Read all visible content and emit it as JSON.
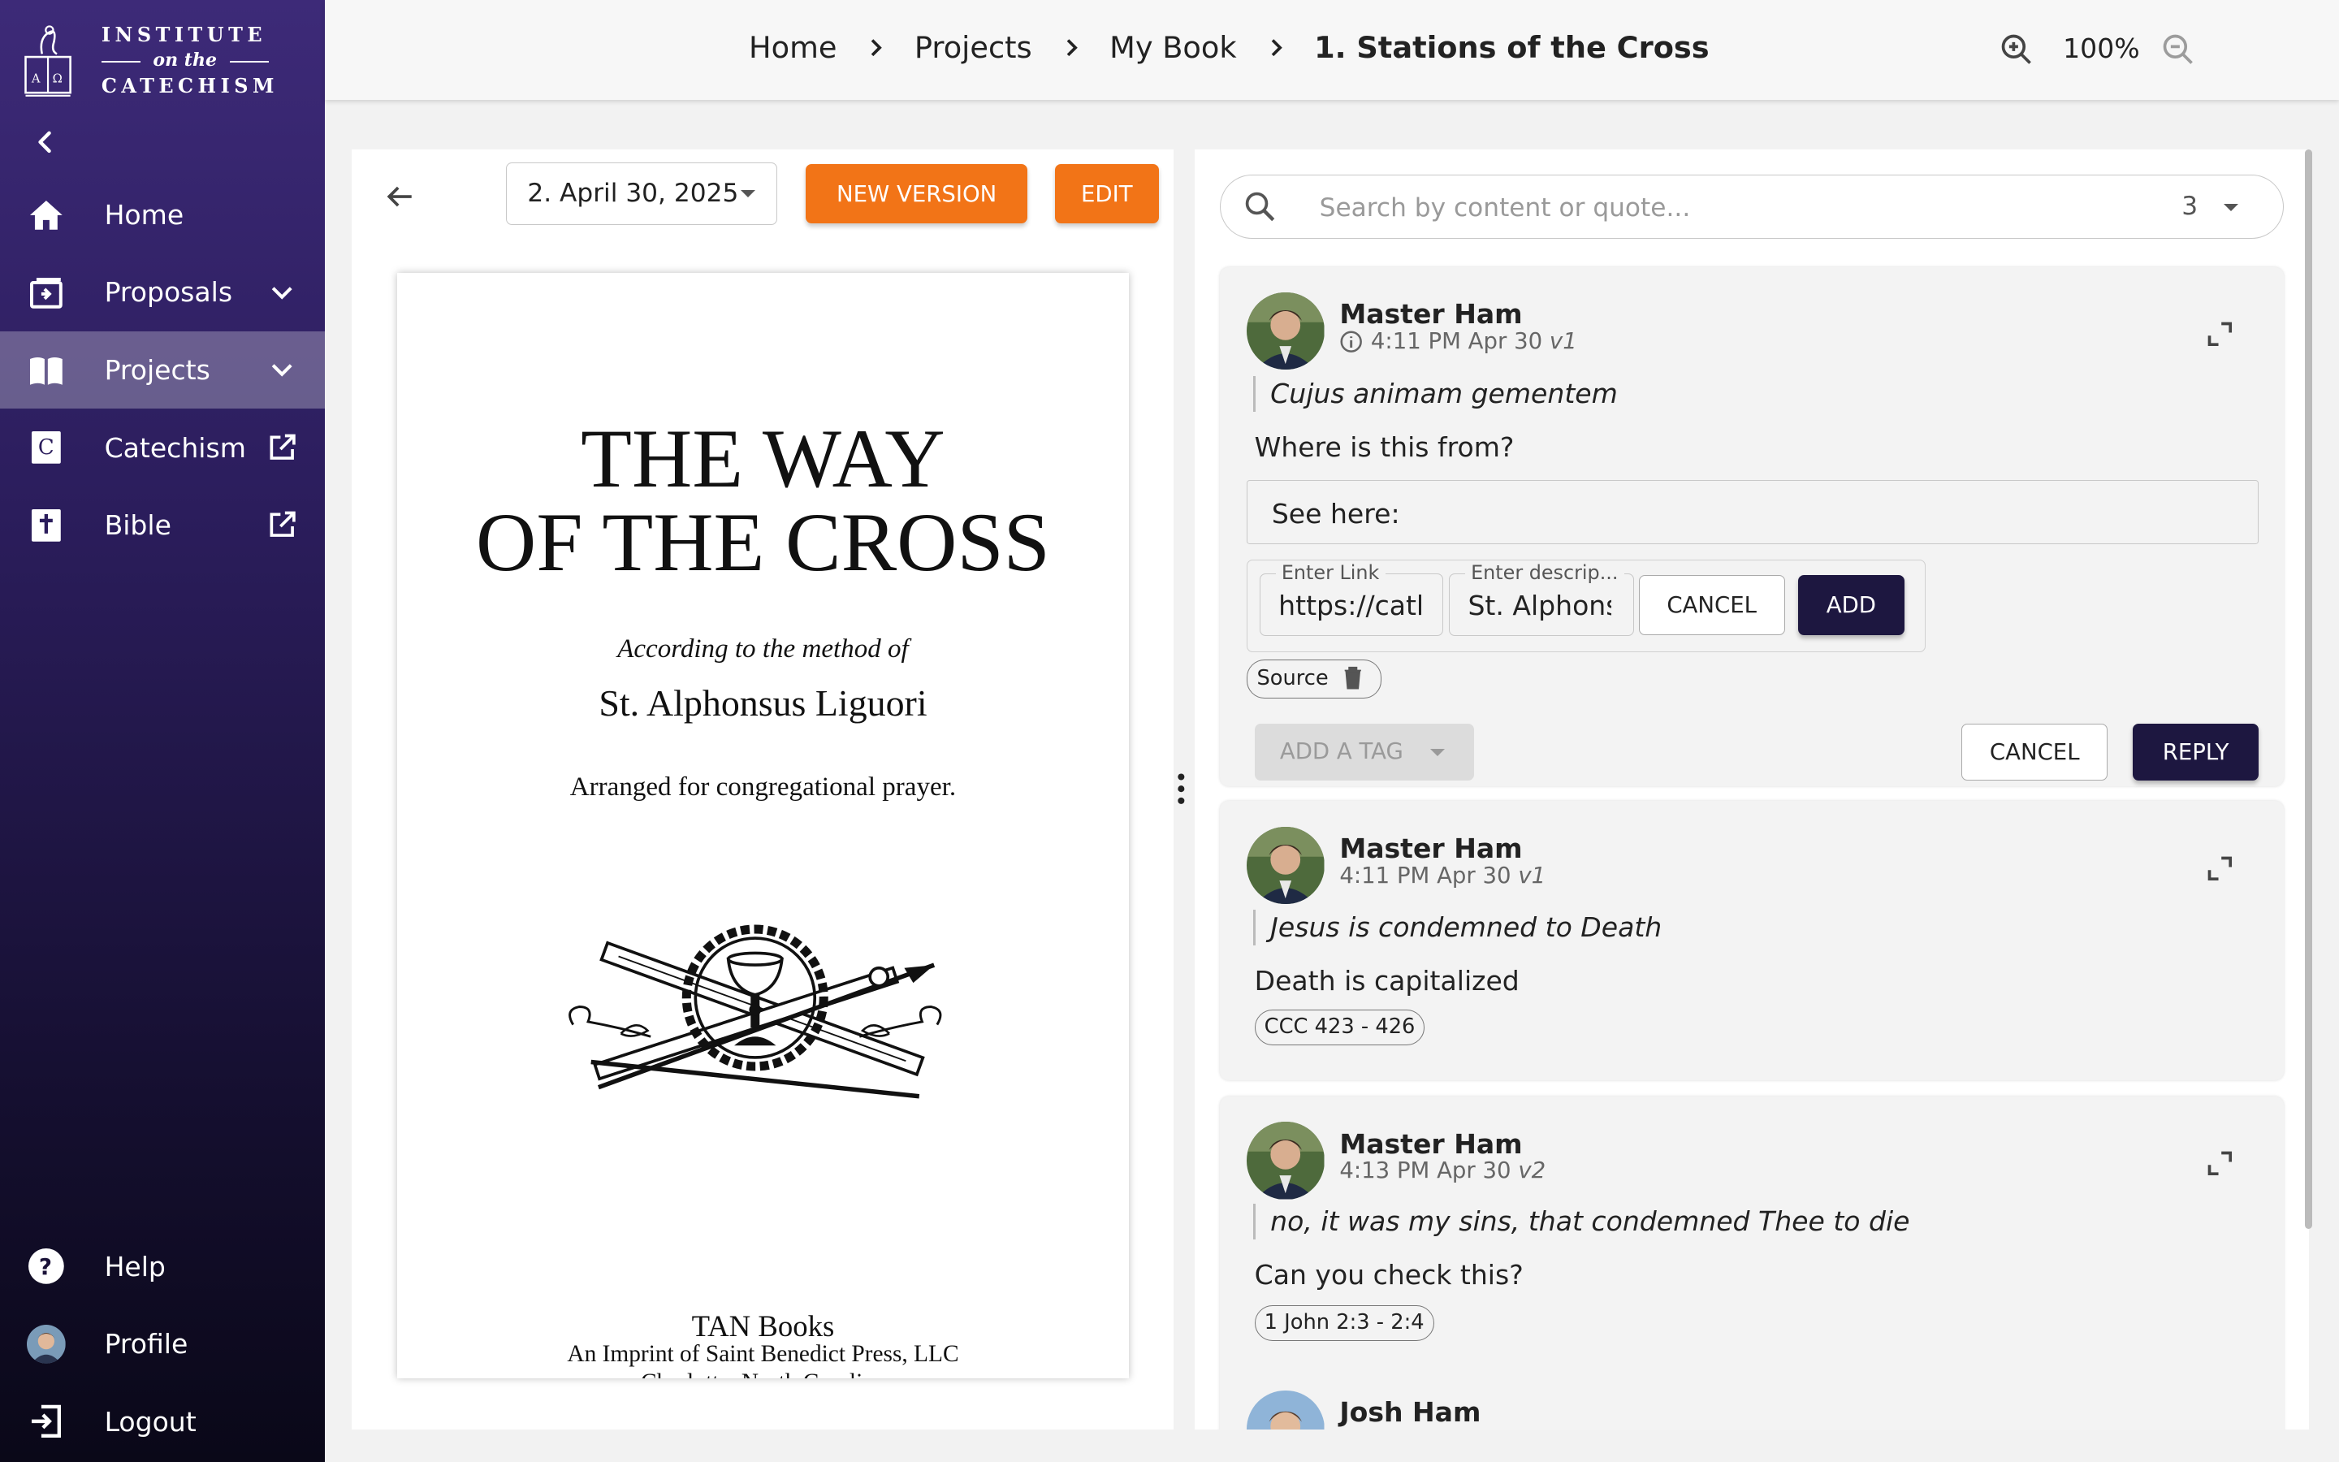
{
  "sidebar": {
    "logo": {
      "line1": "INSTITUTE",
      "line2": "on the",
      "line3": "CATECHISM"
    },
    "items": [
      {
        "label": "Home",
        "icon": "home-icon"
      },
      {
        "label": "Proposals",
        "icon": "proposals-icon"
      },
      {
        "label": "Projects",
        "icon": "book-open-icon",
        "active": true
      },
      {
        "label": "Catechism",
        "icon": "catechism-icon"
      },
      {
        "label": "Bible",
        "icon": "bible-icon"
      }
    ],
    "bottom_items": [
      {
        "label": "Help",
        "icon": "help-icon"
      },
      {
        "label": "Profile",
        "icon": "avatar"
      },
      {
        "label": "Logout",
        "icon": "logout-icon"
      }
    ]
  },
  "breadcrumb": [
    "Home",
    "Projects",
    "My Book",
    "1. Stations of the Cross"
  ],
  "zoom": {
    "value": "100%"
  },
  "document": {
    "version": "2. April 30, 2025",
    "new_version_label": "NEW VERSION",
    "edit_label": "EDIT",
    "page": {
      "title_line1": "THE WAY",
      "title_line2": "OF THE CROSS",
      "method_line": "According to the method of",
      "author": "St. Alphonsus Liguori",
      "arranged": "Arranged for congregational prayer.",
      "publisher": "TAN Books",
      "imprint": "An Imprint of Saint Benedict Press, LLC",
      "location": "Charlotte, North Carolina"
    }
  },
  "comments": {
    "search_placeholder": "Search by content or quote...",
    "count": "3",
    "thread1": {
      "author": "Master Ham",
      "time": "4:11 PM Apr 30",
      "version": "v1",
      "quote": "Cujus animam gementem",
      "body": "Where is this from?",
      "reply_value": "See here:",
      "link_label": "Enter Link",
      "link_value": "https://catholic",
      "desc_label": "Enter descrip...",
      "desc_value": "St. Alphonsus",
      "cancel_small": "CANCEL",
      "add": "ADD",
      "source_chip": "Source",
      "add_tag": "ADD A TAG",
      "cancel": "CANCEL",
      "reply": "REPLY"
    },
    "thread2": {
      "author": "Master Ham",
      "time": "4:11 PM Apr 30",
      "version": "v1",
      "quote": "Jesus is condemned to Death",
      "body": "Death is capitalized",
      "chip": "CCC 423 - 426"
    },
    "thread3": {
      "author": "Master Ham",
      "time": "4:13 PM Apr 30",
      "version": "v2",
      "quote": "no, it was my sins, that condemned Thee to die",
      "body": "Can you check this?",
      "chip": "1 John 2:3 - 2:4"
    },
    "thread4": {
      "author": "Josh Ham"
    }
  },
  "colors": {
    "accent": "#f27417",
    "dark_button": "#1d1740",
    "sidebar_top": "#3d2a78",
    "sidebar_bottom": "#0a0818"
  }
}
